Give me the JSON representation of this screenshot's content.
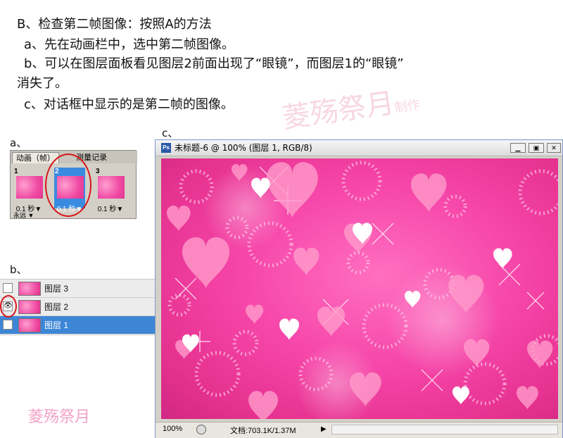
{
  "instructions": {
    "line1": "B、检查第二帧图像：按照A的方法",
    "line2": "a、先在动画栏中，选中第二帧图像。",
    "line3": "b、可以在图层面板看见图层2前面出现了“眼镜”，而图层1的“眼镜”",
    "line4": "消失了。",
    "line5": "c、对话框中显示的是第二帧的图像。"
  },
  "section_labels": {
    "a": "a、",
    "b": "b、",
    "c": "c、"
  },
  "watermark": {
    "text": "菱殇祭月",
    "suffix": "制作"
  },
  "animation_panel": {
    "tabs": [
      "动画（帧）",
      "测量记录"
    ],
    "frames": [
      {
        "number": "1",
        "time": "0.1 秒▼"
      },
      {
        "number": "2",
        "time": "0.1 秒▼"
      },
      {
        "number": "3",
        "time": "0.1 秒▼"
      }
    ],
    "loop_label": "永远 ▼"
  },
  "layers_panel": {
    "layers": [
      {
        "name": "图层 3",
        "visible": false,
        "selected": false
      },
      {
        "name": "图层 2",
        "visible": true,
        "selected": false
      },
      {
        "name": "图层 1",
        "visible": false,
        "selected": true
      }
    ]
  },
  "document_window": {
    "title": "未标题-6 @ 100% (图层 1, RGB/8)",
    "ps_icon": "Ps",
    "zoom": "100%",
    "doc_info": "文档:703.1K/1.37M",
    "buttons": {
      "minimize": "▁",
      "restore": "▣",
      "close": "✕"
    }
  },
  "colors": {
    "canvas_pink": "#f646a9",
    "selection_blue": "#3d86d6",
    "red_ring": "#d8161a"
  }
}
